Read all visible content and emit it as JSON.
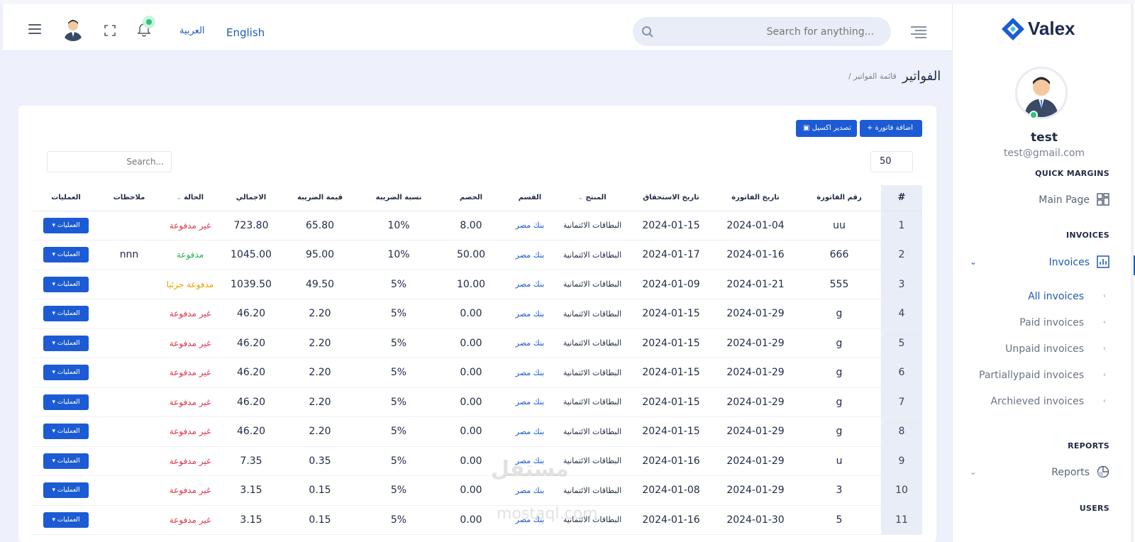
{
  "header": {
    "lang_ar": "العربية",
    "lang_en": "English",
    "search_placeholder": "Search for anything..."
  },
  "sidebar": {
    "brand": "Valex",
    "user_name": "test",
    "user_email": "test@gmail.com",
    "sections": {
      "quick": "QUICK MARGINS",
      "invoices": "INVOICES",
      "reports": "REPORTS",
      "users": "USERS"
    },
    "main_page": "Main Page",
    "invoices": "Invoices",
    "reports": "Reports",
    "sub_items": [
      "All invoices",
      "Paid invoices",
      "Unpaid invoices",
      "Partiallypaid invoices",
      "Archieved invoices"
    ]
  },
  "page": {
    "title": "الفواتير",
    "breadcrumb": "/ قائمة الفواتير"
  },
  "toolbar": {
    "add_label": "+ اضافة فاتورة",
    "export_label": "تصدير اكسيل",
    "page_size": "50",
    "search_placeholder": "Search..."
  },
  "table": {
    "headers": [
      "#",
      "رقم الفاتورة",
      "تاريخ الفاتورة",
      "تاريخ الاستحقاق",
      "المنتج",
      "القسم",
      "الخصم",
      "نسبة الضريبة",
      "قيمة الضريبة",
      "الاجمالي",
      "الحالة",
      "ملاحظات",
      "العمليات"
    ],
    "ops_label": "العمليات",
    "rows": [
      [
        "1",
        "uu",
        "2024-01-04",
        "2024-01-15",
        "البطاقات الائتمانية",
        "بنك مصر",
        "8.00",
        "10%",
        "65.80",
        "723.80",
        "غير مدفوعة",
        ""
      ],
      [
        "2",
        "666",
        "2024-01-16",
        "2024-01-17",
        "البطاقات الائتمانية",
        "بنك مصر",
        "50.00",
        "10%",
        "95.00",
        "1045.00",
        "مدفوعة",
        "nnn"
      ],
      [
        "3",
        "555",
        "2024-01-21",
        "2024-01-09",
        "البطاقات الائتمانية",
        "بنك مصر",
        "10.00",
        "5%",
        "49.50",
        "1039.50",
        "مدفوعة جزئيا",
        ""
      ],
      [
        "4",
        "g",
        "2024-01-29",
        "2024-01-15",
        "البطاقات الائتمانية",
        "بنك مصر",
        "0.00",
        "5%",
        "2.20",
        "46.20",
        "غير مدفوعة",
        ""
      ],
      [
        "5",
        "g",
        "2024-01-29",
        "2024-01-15",
        "البطاقات الائتمانية",
        "بنك مصر",
        "0.00",
        "5%",
        "2.20",
        "46.20",
        "غير مدفوعة",
        ""
      ],
      [
        "6",
        "g",
        "2024-01-29",
        "2024-01-15",
        "البطاقات الائتمانية",
        "بنك مصر",
        "0.00",
        "5%",
        "2.20",
        "46.20",
        "غير مدفوعة",
        ""
      ],
      [
        "7",
        "g",
        "2024-01-29",
        "2024-01-15",
        "البطاقات الائتمانية",
        "بنك مصر",
        "0.00",
        "5%",
        "2.20",
        "46.20",
        "غير مدفوعة",
        ""
      ],
      [
        "8",
        "g",
        "2024-01-29",
        "2024-01-15",
        "البطاقات الائتمانية",
        "بنك مصر",
        "0.00",
        "5%",
        "2.20",
        "46.20",
        "غير مدفوعة",
        ""
      ],
      [
        "9",
        "u",
        "2024-01-29",
        "2024-01-16",
        "البطاقات الائتمانية",
        "بنك مصر",
        "0.00",
        "5%",
        "0.35",
        "7.35",
        "غير مدفوعة",
        ""
      ],
      [
        "10",
        "3",
        "2024-01-29",
        "2024-01-08",
        "البطاقات الائتمانية",
        "بنك مصر",
        "0.00",
        "5%",
        "0.15",
        "3.15",
        "غير مدفوعة",
        ""
      ],
      [
        "11",
        "5",
        "2024-01-30",
        "2024-01-16",
        "البطاقات الائتمانية",
        "بنك مصر",
        "0.00",
        "5%",
        "0.15",
        "3.15",
        "غير مدفوعة",
        ""
      ]
    ]
  },
  "watermark": {
    "ar": "مستقل",
    "en": "mostaql.com"
  }
}
